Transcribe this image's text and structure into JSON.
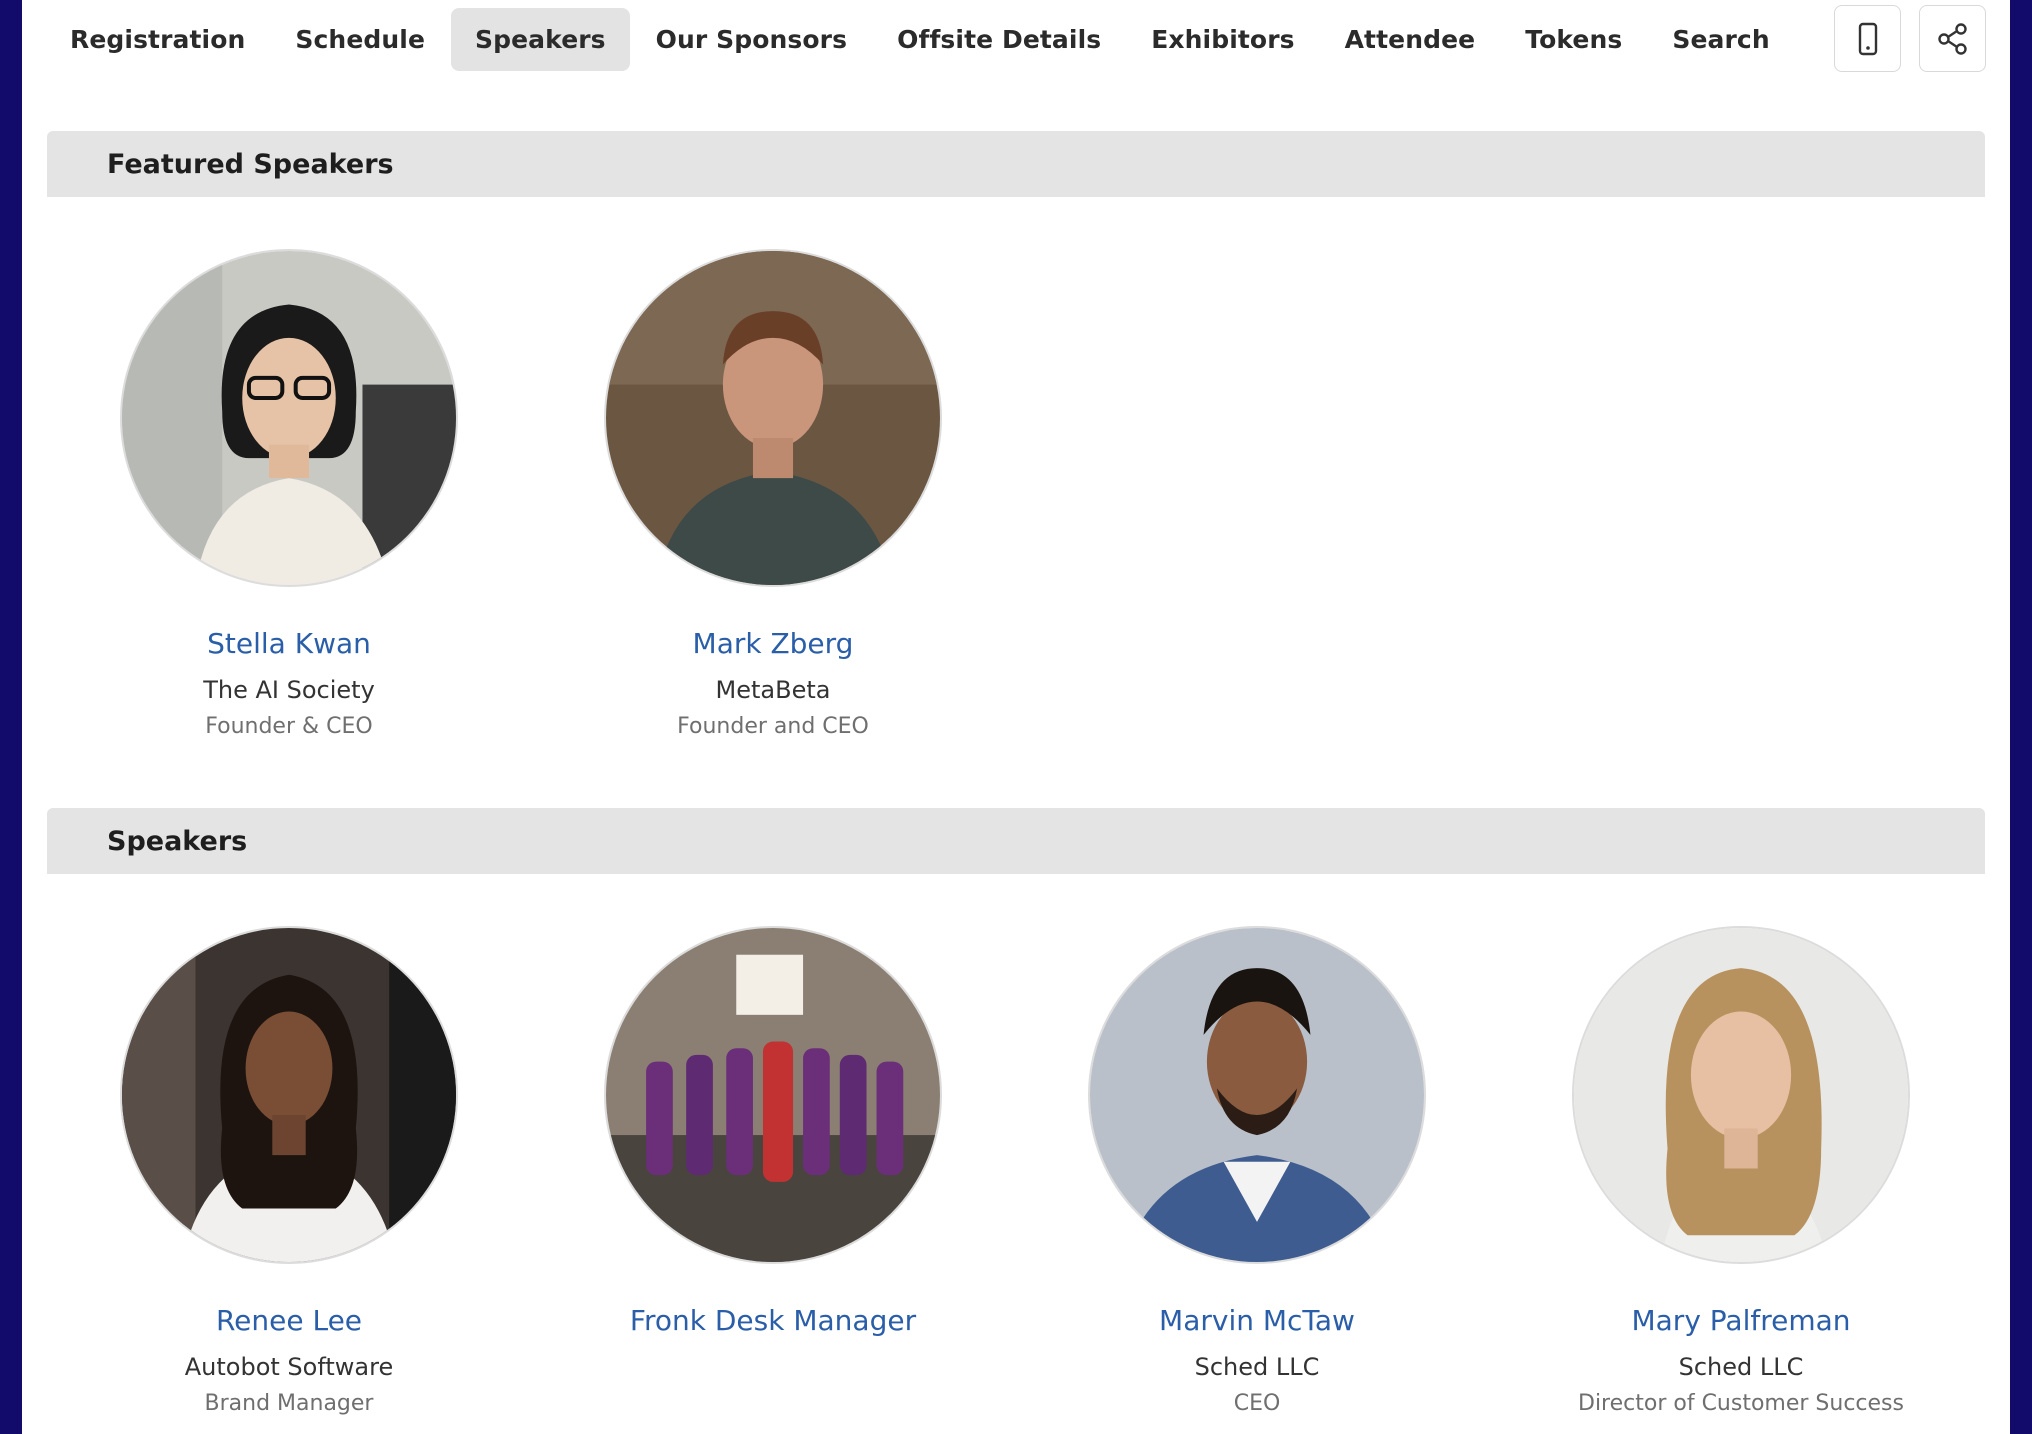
{
  "nav": {
    "tabs": [
      {
        "label": "Registration",
        "active": false
      },
      {
        "label": "Schedule",
        "active": false
      },
      {
        "label": "Speakers",
        "active": true
      },
      {
        "label": "Our Sponsors",
        "active": false
      },
      {
        "label": "Offsite Details",
        "active": false
      },
      {
        "label": "Exhibitors",
        "active": false
      },
      {
        "label": "Attendee",
        "active": false
      },
      {
        "label": "Tokens",
        "active": false
      },
      {
        "label": "Search",
        "active": false
      }
    ],
    "actions": [
      {
        "icon": "mobile-phone-icon"
      },
      {
        "icon": "share-icon"
      }
    ]
  },
  "featured": {
    "title": "Featured Speakers",
    "speakers": [
      {
        "name": "Stella Kwan",
        "company": "The AI Society",
        "role": "Founder & CEO",
        "photo": "woman-glasses-white-blazer"
      },
      {
        "name": "Mark Zberg",
        "company": "MetaBeta",
        "role": "Founder and CEO",
        "photo": "man-dark-sweater"
      }
    ]
  },
  "speakers": {
    "title": "Speakers",
    "speakers": [
      {
        "name": "Renee Lee",
        "company": "Autobot Software",
        "role": "Brand Manager",
        "photo": "woman-white-blouse"
      },
      {
        "name": "Fronk Desk Manager",
        "company": "",
        "role": "",
        "photo": "group-in-purple-dresses"
      },
      {
        "name": "Marvin McTaw",
        "company": "Sched LLC",
        "role": "CEO",
        "photo": "man-blue-blazer"
      },
      {
        "name": "Mary Palfreman",
        "company": "Sched LLC",
        "role": "Director of Customer Success",
        "photo": "woman-blonde-hair"
      }
    ]
  },
  "colors": {
    "page_background": "#130b6b",
    "link": "#2a5ea8",
    "active_tab": "#e3e3e3",
    "section_header": "#e4e4e4"
  }
}
